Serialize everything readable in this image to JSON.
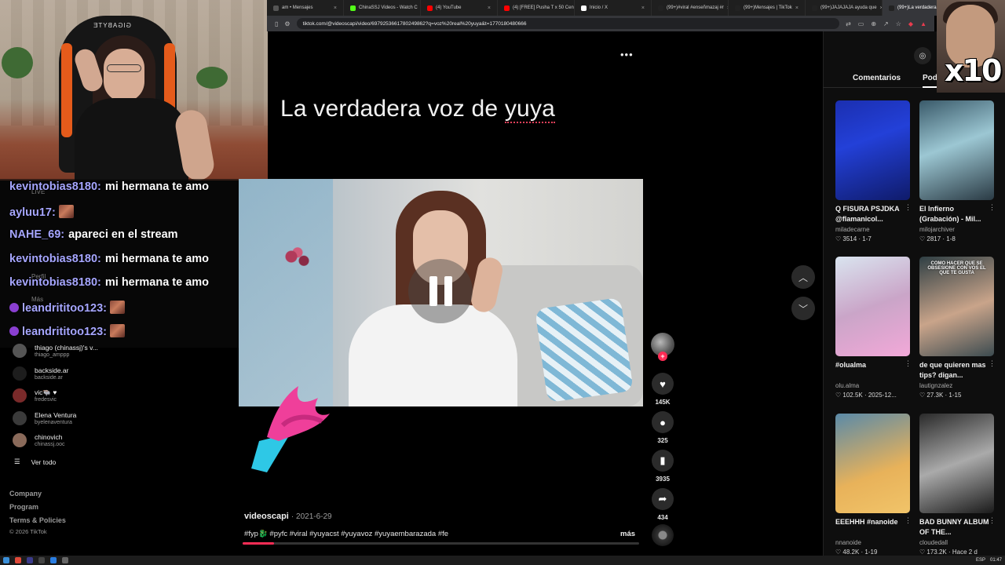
{
  "browser": {
    "tabs": [
      {
        "label": "am • Mensajes",
        "color": "#555555"
      },
      {
        "label": "ChinaSSJ Videos - Watch C",
        "color": "#53fc18"
      },
      {
        "label": "(4) YouTube",
        "color": "#ff0000"
      },
      {
        "label": "(4) [FREE] Pusha T x 50 Cen",
        "color": "#ff0000"
      },
      {
        "label": "Inicio / X",
        "color": "#ffffff"
      },
      {
        "label": "(99+)#viral #enseñmazaj #r",
        "color": "#222222"
      },
      {
        "label": "(99+)Mensajes | TikTok",
        "color": "#222222"
      },
      {
        "label": "(99+)JAJAJAJA ayuda que",
        "color": "#222222"
      },
      {
        "label": "(99+)La verdadera v",
        "color": "#222222"
      }
    ],
    "new_tab": "+",
    "url": "tiktok.com/@videoscapi/video/6979253661780249862?q=voz%20real%20yuya&t=1770180480666"
  },
  "chat": [
    {
      "user": "kevintobias8180:",
      "msg": "mi hermana te amo",
      "emote": false,
      "devil": false
    },
    {
      "user": "ayluu17:",
      "msg": "",
      "emote": true,
      "devil": false
    },
    {
      "user": "NAHE_69:",
      "msg": "apareci en el stream",
      "emote": false,
      "devil": false
    },
    {
      "user": "kevintobias8180:",
      "msg": "mi hermana te amo",
      "emote": false,
      "devil": false
    },
    {
      "user": "kevintobias8180:",
      "msg": "mi hermana te amo",
      "emote": false,
      "devil": false
    },
    {
      "user": "leandrititoo123:",
      "msg": "",
      "emote": true,
      "devil": true
    },
    {
      "user": "leandrititoo123:",
      "msg": "",
      "emote": true,
      "devil": true
    }
  ],
  "ghost_nav": [
    "LIVE",
    "Perfil",
    "Más"
  ],
  "following": [
    {
      "name": "thiago (chinassj)'s v...",
      "handle": "thiago_amppp"
    },
    {
      "name": "backside.ar",
      "handle": "backside.ar"
    },
    {
      "name": "vic🐃 ♥",
      "handle": "fredesvic"
    },
    {
      "name": "Elena Ventura",
      "handle": "byelenaventura"
    },
    {
      "name": "chinovich",
      "handle": "chinassj.ooc"
    }
  ],
  "ver_todo": "Ver todo",
  "footer": {
    "company": "Company",
    "program": "Program",
    "terms": "Terms & Policies",
    "copyright": "© 2026 TikTok"
  },
  "video": {
    "headline_part1": "La verdadera voz de ",
    "headline_part2": "yuya",
    "author": "videoscapi",
    "date": "· 2021-6-29",
    "tags": "#fyp🐉 #pyfc #viral #yuyacst #yuyavoz #yuyaembarazada #fe",
    "more": "más",
    "progress_fraction": 0.08
  },
  "actions": {
    "likes": "145K",
    "comments": "325",
    "saves": "3935",
    "shares": "434"
  },
  "right_panel": {
    "tab_comments": "Comentarios",
    "tab_related": "Podría",
    "cards": [
      {
        "title": "Q FISURA PSJDKA @flamanicol...",
        "author": "miladecarne",
        "stats": "♡ 3514 · 1-7",
        "thumb_text": ""
      },
      {
        "title": "El Infierno (Grabación) - Mil...",
        "author": "milojarchiver",
        "stats": "♡ 2817 · 1-8",
        "thumb_text": ""
      },
      {
        "title": "#olualma",
        "author": "olu.alma",
        "stats": "♡ 102.5K · 2025-12...",
        "thumb_text": ""
      },
      {
        "title": "de que quieren mas tips? digan...",
        "author": "lautignzalez",
        "stats": "♡ 27.3K · 1-15",
        "thumb_text": "COMO HACER QUE SE OBSESIONE CON VOS EL QUE TE GUSTA"
      },
      {
        "title": "EEEHHH #nanoide",
        "author": "nnanoide",
        "stats": "♡ 48.2K · 1-19",
        "thumb_text": ""
      },
      {
        "title": "BAD BUNNY ALBUM OF THE...",
        "author": "cloudedall",
        "stats": "♡ 173.2K · Hace 2 d",
        "thumb_text": ""
      }
    ]
  },
  "overlay": {
    "x10": "x10"
  },
  "webcam": {
    "chair_logo": "GIGABYTE"
  },
  "taskbar": {
    "lang": "ESP",
    "time": "01:47"
  }
}
